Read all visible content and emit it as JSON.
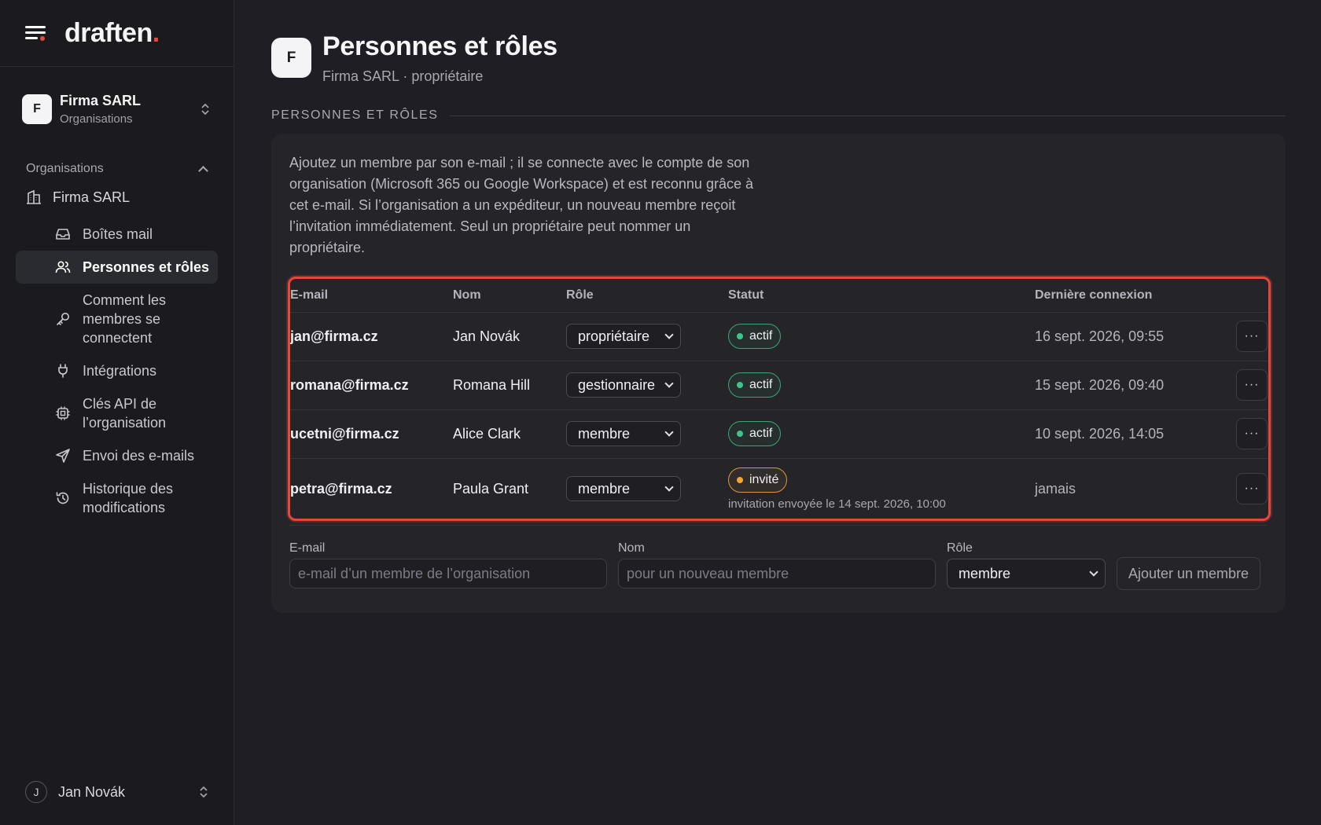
{
  "brand": {
    "logo_text": "draften",
    "logo_dot": "."
  },
  "org_switcher": {
    "initial": "F",
    "name": "Firma SARL",
    "subtitle": "Organisations"
  },
  "sidebar": {
    "section_label": "Organisations",
    "org_item": "Firma SARL",
    "items": [
      {
        "label": "Boîtes mail",
        "icon": "inbox-icon"
      },
      {
        "label": "Personnes et rôles",
        "icon": "users-icon",
        "active": true
      },
      {
        "label": "Comment les membres se connectent",
        "icon": "key-icon"
      },
      {
        "label": "Intégrations",
        "icon": "plug-icon"
      },
      {
        "label": "Clés API de l’organisation",
        "icon": "chip-icon"
      },
      {
        "label": "Envoi des e-mails",
        "icon": "send-icon"
      },
      {
        "label": "Historique des modifications",
        "icon": "history-icon"
      }
    ]
  },
  "user": {
    "initial": "J",
    "name": "Jan Novák"
  },
  "header": {
    "initial": "F",
    "title": "Personnes et rôles",
    "subtitle": "Firma SARL · propriétaire"
  },
  "section_title": "PERSONNES ET RÔLES",
  "description": "Ajoutez un membre par son e-mail ; il se connecte avec le compte de son organisation (Microsoft 365 ou Google Workspace) et est reconnu grâce à cet e-mail. Si l’organisation a un expéditeur, un nouveau membre reçoit l’invitation immédiatement. Seul un propriétaire peut nommer un propriétaire.",
  "table": {
    "columns": {
      "email": "E-mail",
      "name": "Nom",
      "role": "Rôle",
      "status": "Statut",
      "last_login": "Dernière connexion"
    },
    "rows": [
      {
        "email": "jan@firma.cz",
        "name": "Jan Novák",
        "role": "propriétaire",
        "status": "actif",
        "last_login": "16 sept. 2026, 09:55"
      },
      {
        "email": "romana@firma.cz",
        "name": "Romana Hill",
        "role": "gestionnaire",
        "status": "actif",
        "last_login": "15 sept. 2026, 09:40"
      },
      {
        "email": "ucetni@firma.cz",
        "name": "Alice Clark",
        "role": "membre",
        "status": "actif",
        "last_login": "10 sept. 2026, 14:05"
      },
      {
        "email": "petra@firma.cz",
        "name": "Paula Grant",
        "role": "membre",
        "status": "invité",
        "note": "invitation envoyée le 14 sept. 2026, 10:00",
        "last_login": "jamais"
      }
    ],
    "more_label": "···"
  },
  "add_form": {
    "email_label": "E-mail",
    "email_placeholder": "e-mail d’un membre de l’organisation",
    "name_label": "Nom",
    "name_placeholder": "pour un nouveau membre",
    "role_label": "Rôle",
    "role_value": "membre",
    "submit_label": "Ajouter un membre"
  },
  "colors": {
    "accent": "#e5483a",
    "active": "#3ec48a",
    "invited": "#f0a43a",
    "background": "#1e1e24"
  }
}
